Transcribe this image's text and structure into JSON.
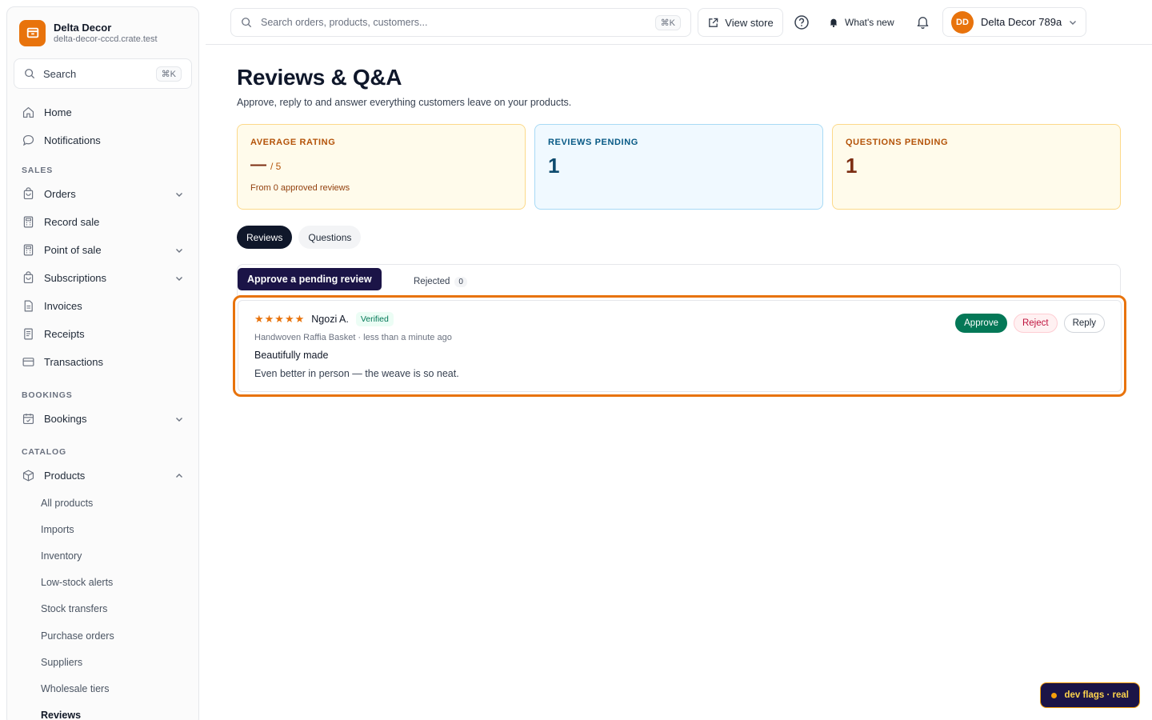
{
  "brand": {
    "name": "Delta Decor",
    "domain": "delta-decor-cccd.crate.test"
  },
  "sidebar": {
    "search_label": "Search",
    "search_shortcut": "⌘K",
    "top_items": [
      {
        "label": "Home",
        "icon": "home-icon"
      },
      {
        "label": "Notifications",
        "icon": "chat-bubble-icon"
      }
    ],
    "sections": {
      "sales": "SALES",
      "bookings": "BOOKINGS",
      "catalog": "CATALOG"
    },
    "sales_items": [
      {
        "label": "Orders",
        "icon": "bag-icon",
        "expandable": true
      },
      {
        "label": "Record sale",
        "icon": "calculator-icon",
        "expandable": false
      },
      {
        "label": "Point of sale",
        "icon": "calculator-icon",
        "expandable": true
      },
      {
        "label": "Subscriptions",
        "icon": "bag-icon",
        "expandable": true
      },
      {
        "label": "Invoices",
        "icon": "document-icon",
        "expandable": false
      },
      {
        "label": "Receipts",
        "icon": "receipt-icon",
        "expandable": false
      },
      {
        "label": "Transactions",
        "icon": "credit-card-icon",
        "expandable": false
      }
    ],
    "bookings_items": [
      {
        "label": "Bookings",
        "icon": "calendar-icon",
        "expandable": true
      }
    ],
    "catalog_items": [
      {
        "label": "Products",
        "icon": "box-icon",
        "expanded": true
      }
    ],
    "product_subitems": [
      "All products",
      "Imports",
      "Inventory",
      "Low-stock alerts",
      "Stock transfers",
      "Purchase orders",
      "Suppliers",
      "Wholesale tiers",
      "Reviews"
    ]
  },
  "topbar": {
    "search_placeholder": "Search orders, products, customers...",
    "search_shortcut": "⌘K",
    "view_store": "View store",
    "whats_new": "What's new",
    "account_initials": "DD",
    "account_name": "Delta Decor 789a"
  },
  "page": {
    "title": "Reviews & Q&A",
    "subtitle": "Approve, reply to and answer everything customers leave on your products."
  },
  "stats": {
    "average_rating": {
      "label": "AVERAGE RATING",
      "value": "—",
      "suffix": "/ 5",
      "note": "From 0 approved reviews"
    },
    "reviews_pending": {
      "label": "REVIEWS PENDING",
      "value": "1"
    },
    "questions_pending": {
      "label": "QUESTIONS PENDING",
      "value": "1"
    }
  },
  "tabs": {
    "reviews": "Reviews",
    "questions": "Questions"
  },
  "filters": {
    "rejected_label": "Rejected",
    "rejected_count": "0"
  },
  "tooltip": "Approve a pending review",
  "review": {
    "stars": "★★★★★",
    "rating": 5,
    "author": "Ngozi A.",
    "badge": "Verified",
    "meta": "Handwoven Raffia Basket · less than a minute ago",
    "title": "Beautifully made",
    "body": "Even better in person — the weave is so neat.",
    "actions": {
      "approve": "Approve",
      "reject": "Reject",
      "reply": "Reply"
    }
  },
  "devflags": "dev flags · real",
  "colors": {
    "accent": "#e8730c",
    "approve": "#047857",
    "reject": "#be123c",
    "dark": "#0f172a"
  }
}
